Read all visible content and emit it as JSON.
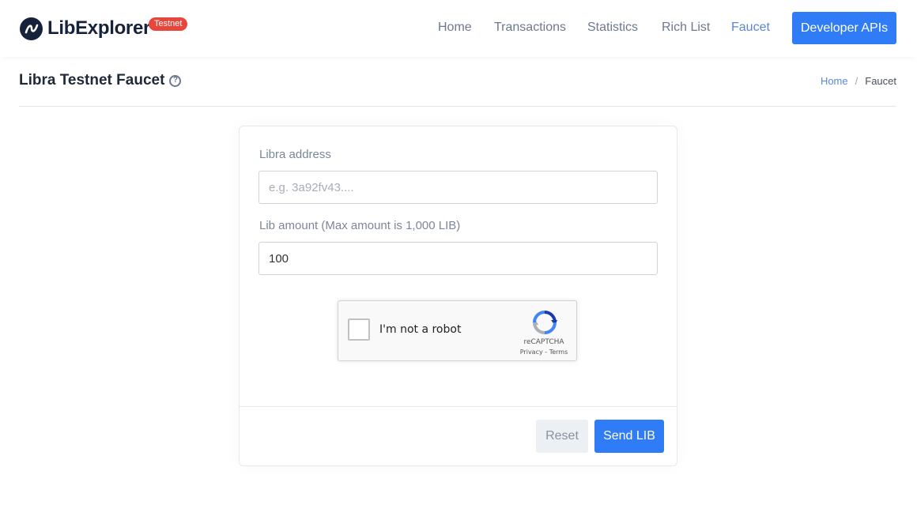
{
  "header": {
    "logo_text": "LibExplorer",
    "badge": "Testnet",
    "nav": [
      {
        "label": "Home",
        "active": false
      },
      {
        "label": "Transactions",
        "active": false
      },
      {
        "label": "Statistics",
        "active": false
      },
      {
        "label": "Rich List",
        "active": false
      },
      {
        "label": "Faucet",
        "active": true
      }
    ],
    "cta_label": "Developer APIs"
  },
  "page": {
    "title": "Libra Testnet Faucet",
    "help_icon": "question-circle-icon",
    "breadcrumb": {
      "home": "Home",
      "separator": "/",
      "current": "Faucet"
    }
  },
  "form": {
    "address_label": "Libra address",
    "address_placeholder": "e.g. 3a92fv43....",
    "address_value": "",
    "amount_label": "Lib amount (Max amount is 1,000 LIB)",
    "amount_value": "100",
    "recaptcha": {
      "label": "I'm not a robot",
      "brand": "reCAPTCHA",
      "links": "Privacy - Terms",
      "checked": false
    },
    "reset_label": "Reset",
    "submit_label": "Send LIB"
  },
  "colors": {
    "primary": "#2f7cf6",
    "brand_dark": "#16213a",
    "badge_red": "#e8453c",
    "active_nav": "#5b87d6"
  }
}
